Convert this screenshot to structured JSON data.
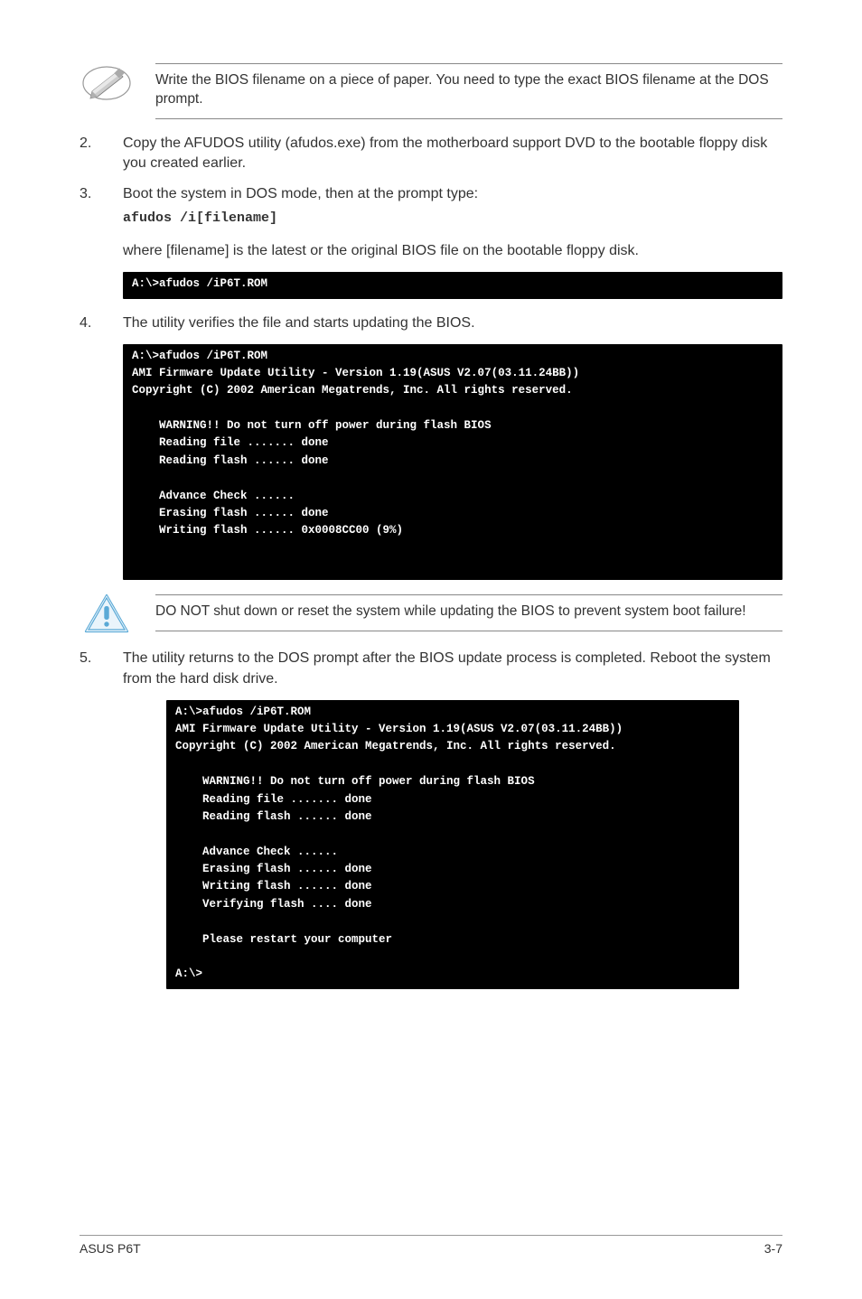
{
  "note1": "Write the BIOS filename on a piece of paper. You need to type the exact BIOS filename at the DOS prompt.",
  "steps": {
    "s2": {
      "num": "2.",
      "text": "Copy the AFUDOS utility (afudos.exe) from the motherboard support DVD to the bootable floppy disk you created earlier."
    },
    "s3": {
      "num": "3.",
      "text": "Boot the system in DOS mode, then at the prompt type:"
    },
    "s3_cmd": "afudos /i[filename]",
    "s3_follow": "where [filename] is the latest or the original BIOS file on the bootable floppy disk.",
    "s4": {
      "num": "4.",
      "text": "The utility verifies the file and starts updating the BIOS."
    },
    "s5": {
      "num": "5.",
      "text": "The utility returns to the DOS prompt after the BIOS update process is completed. Reboot the system from the hard disk drive."
    }
  },
  "terminal1": "A:\\>afudos /iP6T.ROM",
  "terminal2": "A:\\>afudos /iP6T.ROM\nAMI Firmware Update Utility - Version 1.19(ASUS V2.07(03.11.24BB))\nCopyright (C) 2002 American Megatrends, Inc. All rights reserved.\n\n    WARNING!! Do not turn off power during flash BIOS\n    Reading file ....... done\n    Reading flash ...... done\n\n    Advance Check ......\n    Erasing flash ...... done\n    Writing flash ...... 0x0008CC00 (9%)\n\n\n",
  "caution": "DO NOT shut down or reset the system while updating the BIOS to prevent system boot failure!",
  "terminal3": "A:\\>afudos /iP6T.ROM\nAMI Firmware Update Utility - Version 1.19(ASUS V2.07(03.11.24BB))\nCopyright (C) 2002 American Megatrends, Inc. All rights reserved.\n\n    WARNING!! Do not turn off power during flash BIOS\n    Reading file ....... done\n    Reading flash ...... done\n\n    Advance Check ......\n    Erasing flash ...... done\n    Writing flash ...... done\n    Verifying flash .... done\n\n    Please restart your computer\n\nA:\\>",
  "footer": {
    "left": "ASUS P6T",
    "right": "3-7"
  }
}
